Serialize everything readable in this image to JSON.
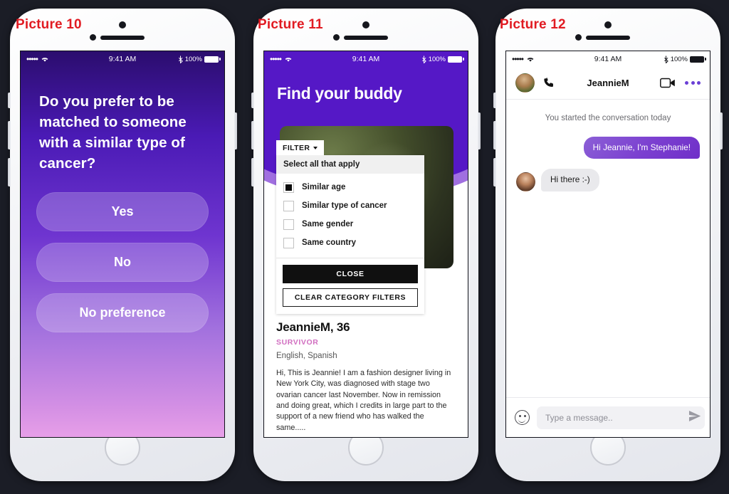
{
  "labels": {
    "pic1": "Picture 10",
    "pic2": "Picture 11",
    "pic3": "Picture 12"
  },
  "statusbar": {
    "time": "9:41 AM",
    "battery": "100%",
    "dots": "•••••"
  },
  "screen1": {
    "question": "Do you prefer to be matched to someone with a similar type of cancer?",
    "answers": [
      {
        "label": "Yes"
      },
      {
        "label": "No"
      },
      {
        "label": "No preference"
      }
    ]
  },
  "screen2": {
    "title": "Find your buddy",
    "filter_tab": "FILTER",
    "panel_heading": "Select all that apply",
    "options": [
      {
        "label": "Similar age",
        "checked": true
      },
      {
        "label": "Similar type of cancer",
        "checked": false
      },
      {
        "label": "Same gender",
        "checked": false
      },
      {
        "label": "Same country",
        "checked": false
      }
    ],
    "close_label": "CLOSE",
    "clear_label": "CLEAR CATEGORY FILTERS",
    "profile": {
      "name": "JeannieM, 36",
      "tag": "SURVIVOR",
      "languages": "English, Spanish",
      "bio": "Hi, This is Jeannie! I am a fashion designer living in New York City, was diagnosed with stage two ovarian cancer last November. Now in remission and doing great, which I credits in large part to the support of a new friend who has walked the same....."
    }
  },
  "screen3": {
    "contact_name": "JeannieM",
    "conversation_note": "You started the conversation today",
    "messages": [
      {
        "text": "Hi Jeannie, I'm Stephanie!",
        "from": "me"
      },
      {
        "text": "Hi there :-)",
        "from": "them"
      }
    ],
    "input_placeholder": "Type a message.."
  },
  "colors": {
    "label_red": "#e11b22",
    "header_purple": "#5518c6",
    "arc_purple": "#a06fe0",
    "survivor_pink": "#d16ec0",
    "bubble_purple": "#7b3fd0"
  }
}
